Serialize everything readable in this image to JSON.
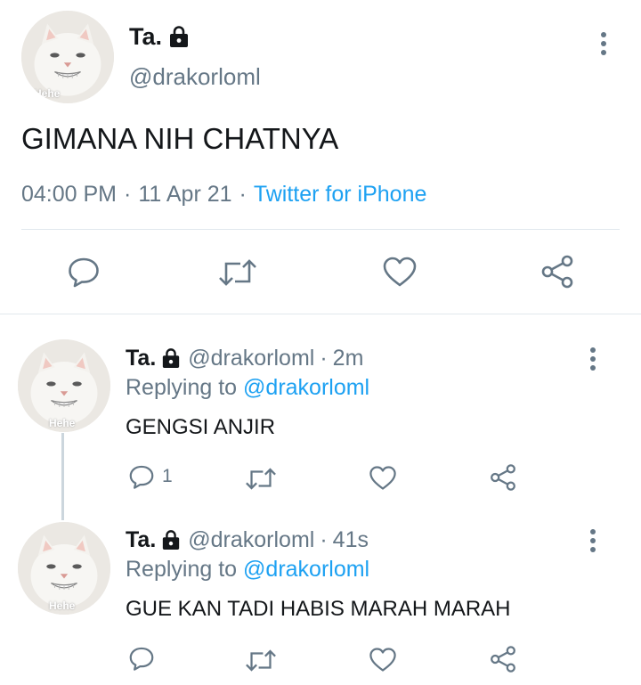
{
  "main_tweet": {
    "display_name": "Ta.",
    "handle": "@drakorloml",
    "text": "GIMANA NIH CHATNYA",
    "time": "04:00 PM",
    "sep1": "·",
    "date": "11 Apr 21",
    "sep2": "·",
    "source": "Twitter for iPhone",
    "avatar_caption": "Hehe"
  },
  "replies": [
    {
      "display_name": "Ta.",
      "handle": "@drakorloml",
      "sep": "·",
      "age": "2m",
      "replying_prefix": "Replying to",
      "replying_to": "@drakorloml",
      "text": "GENGSI ANJIR",
      "reply_count": "1",
      "avatar_caption": "Hehe"
    },
    {
      "display_name": "Ta.",
      "handle": "@drakorloml",
      "sep": "·",
      "age": "41s",
      "replying_prefix": "Replying to",
      "replying_to": "@drakorloml",
      "text": "GUE KAN TADI HABIS MARAH MARAH",
      "reply_count": "",
      "avatar_caption": "Hehe"
    }
  ],
  "colors": {
    "text": "#14171a",
    "muted": "#657786",
    "accent": "#1da1f2",
    "divider": "#e1e8ed"
  },
  "icons": [
    "lock-icon",
    "more-icon",
    "reply-icon",
    "retweet-icon",
    "like-icon",
    "share-icon"
  ]
}
